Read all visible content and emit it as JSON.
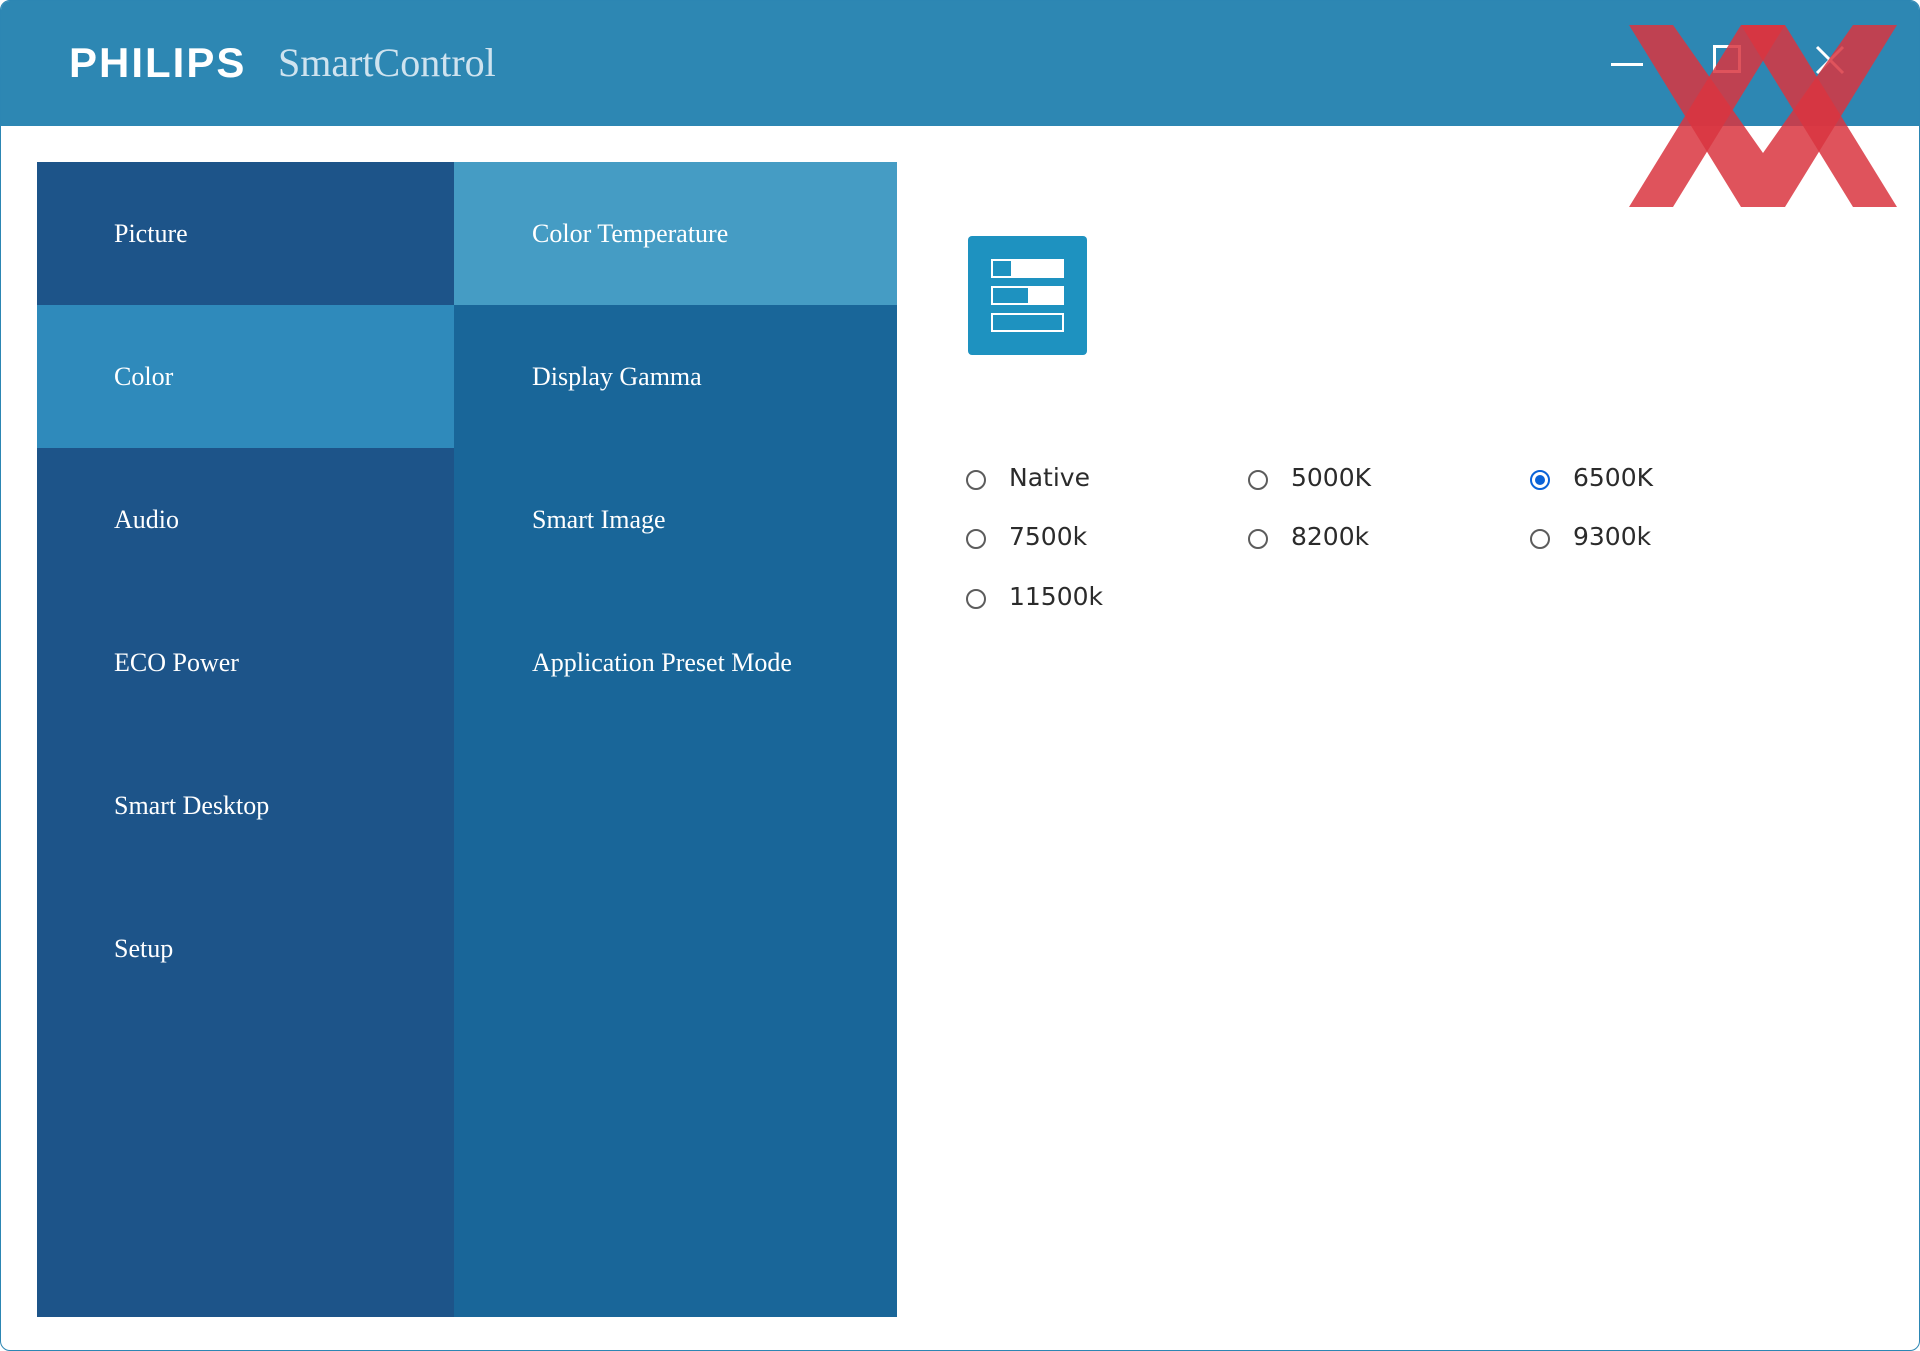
{
  "header": {
    "brand": "PHILIPS",
    "app_title": "SmartControl"
  },
  "window_controls": [
    "minimize",
    "maximize",
    "close"
  ],
  "primary_nav": {
    "items": [
      {
        "label": "Picture",
        "active": false
      },
      {
        "label": "Color",
        "active": true
      },
      {
        "label": "Audio",
        "active": false
      },
      {
        "label": "ECO Power",
        "active": false
      },
      {
        "label": "Smart Desktop",
        "active": false
      },
      {
        "label": "Setup",
        "active": false
      }
    ]
  },
  "secondary_nav": {
    "items": [
      {
        "label": "Color Temperature",
        "active": true
      },
      {
        "label": "Display Gamma",
        "active": false
      },
      {
        "label": "Smart Image",
        "active": false
      },
      {
        "label": "Application Preset Mode",
        "active": false
      }
    ]
  },
  "content": {
    "icon": "color-temperature-settings-icon",
    "color_temperature_options": [
      {
        "label": "Native",
        "checked": false
      },
      {
        "label": "5000K",
        "checked": false
      },
      {
        "label": "6500K",
        "checked": true
      },
      {
        "label": "7500k",
        "checked": false
      },
      {
        "label": "8200k",
        "checked": false
      },
      {
        "label": "9300k",
        "checked": false
      },
      {
        "label": "11500k",
        "checked": false
      }
    ],
    "selected": "6500K"
  },
  "colors": {
    "titlebar": "#2d87b3",
    "primary_nav": "#1d5489",
    "primary_nav_active": "#2f8abb",
    "secondary_nav": "#196699",
    "secondary_nav_active": "#459cc4",
    "radio_checked": "#0a63d8",
    "watermark": "#d9353f"
  }
}
